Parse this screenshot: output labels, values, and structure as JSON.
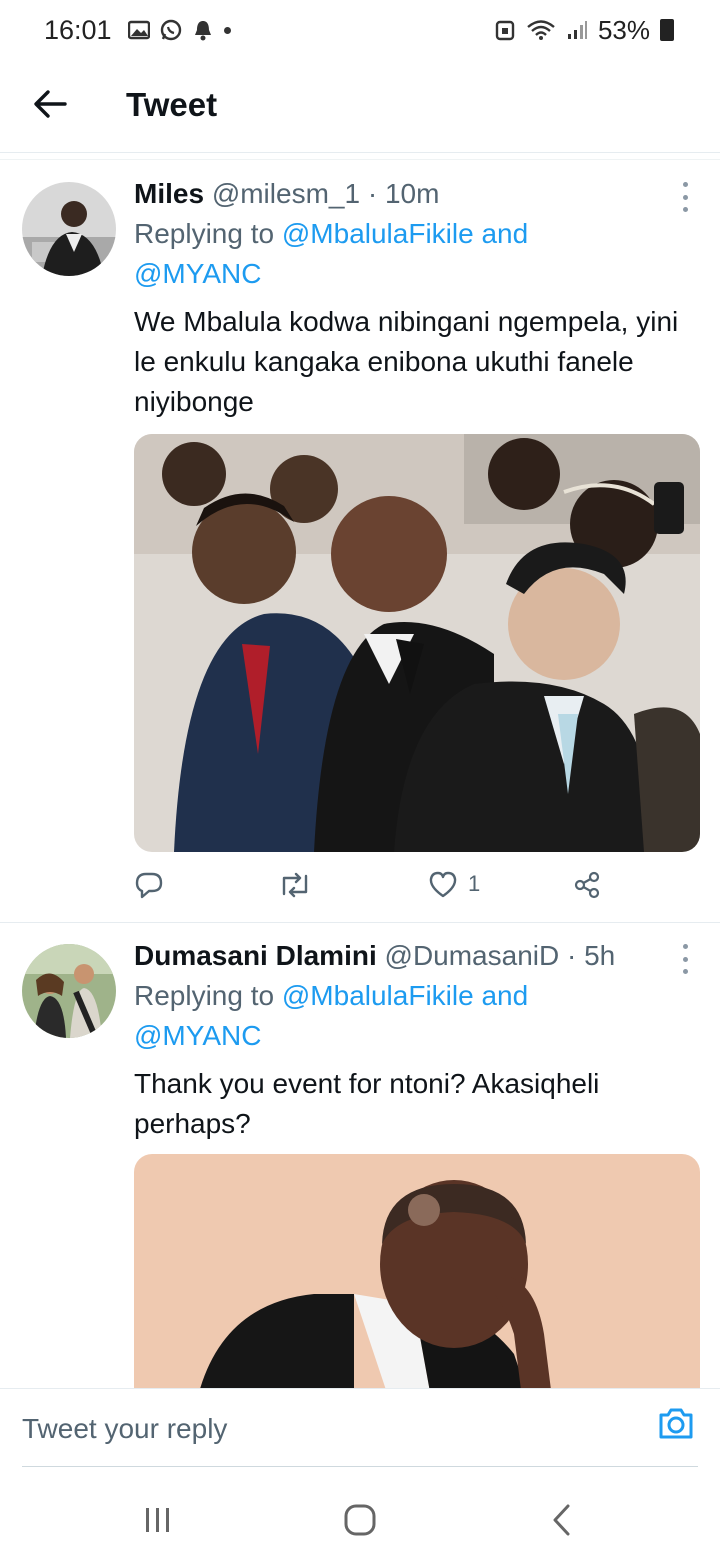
{
  "status_bar": {
    "time": "16:01",
    "battery": "53%",
    "left_icons": [
      "gallery-icon",
      "whatsapp-icon",
      "bell-icon",
      "dot-icon"
    ],
    "right_icons": [
      "lock-icon",
      "wifi-icon",
      "signal-icon",
      "battery-icon"
    ]
  },
  "header": {
    "title": "Tweet",
    "back_icon": "arrow-left-icon"
  },
  "tweets": [
    {
      "name": "Miles",
      "handle": "@milesm_1",
      "sep": "·",
      "time": "10m",
      "replying_prefix": "Replying to",
      "mention1": "@MbalulaFikile",
      "and": "and",
      "mention2": "@MYANC",
      "text": "We Mbalula kodwa nibingani ngempela, yini le enkulu kangaka enibona ukuthi fanele niyibonge",
      "likes": "1"
    },
    {
      "name": "Dumasani Dlamini",
      "handle": "@DumasaniD",
      "sep": "·",
      "time": "5h",
      "replying_prefix": "Replying to",
      "mention1": "@MbalulaFikile",
      "and": "and",
      "mention2": "@MYANC",
      "text": "Thank you event for ntoni? Akasiqheli perhaps?"
    }
  ],
  "reply_bar": {
    "placeholder": "Tweet your reply"
  },
  "colors": {
    "accent": "#1d9bf0",
    "text": "#0f1419",
    "muted": "#536471"
  }
}
